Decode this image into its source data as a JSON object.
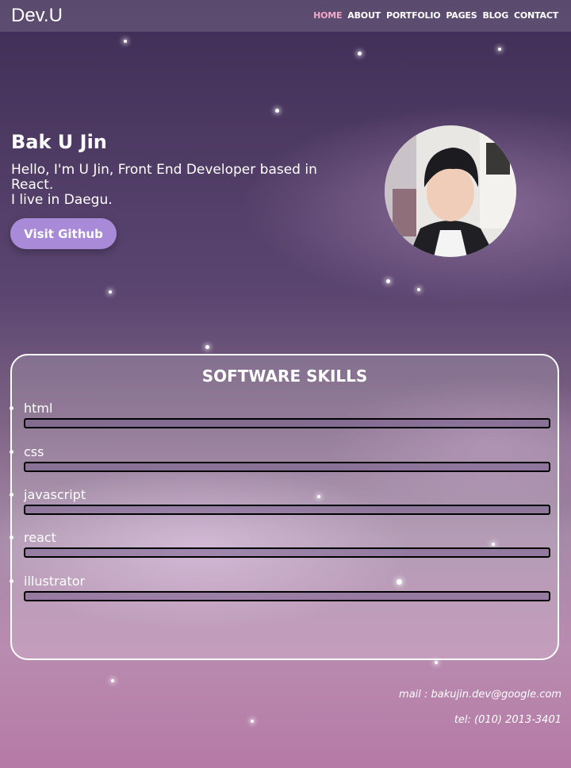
{
  "header": {
    "logo": "Dev.U",
    "nav": [
      "HOME",
      "ABOUT",
      "PORTFOLIO",
      "PAGES",
      "BLOG",
      "CONTACT"
    ],
    "active": "HOME"
  },
  "hero": {
    "name": "Bak U Jin",
    "intro_line1": "Hello, I'm U Jin, Front End Developer based in React.",
    "intro_line2": "I live in Daegu.",
    "button": "Visit Github"
  },
  "skills": {
    "title": "SOFTWARE SKILLS",
    "items": [
      {
        "label": "html",
        "level": 0
      },
      {
        "label": "css",
        "level": 0
      },
      {
        "label": "javascript",
        "level": 0
      },
      {
        "label": "react",
        "level": 0
      },
      {
        "label": "illustrator",
        "level": 0
      }
    ]
  },
  "contact": {
    "mail": "mail : bakujin.dev@google.com",
    "tel": "tel: (010) 2013-3401"
  },
  "colors": {
    "active_nav": "#f4a8c8",
    "button": "#a88ad8"
  }
}
